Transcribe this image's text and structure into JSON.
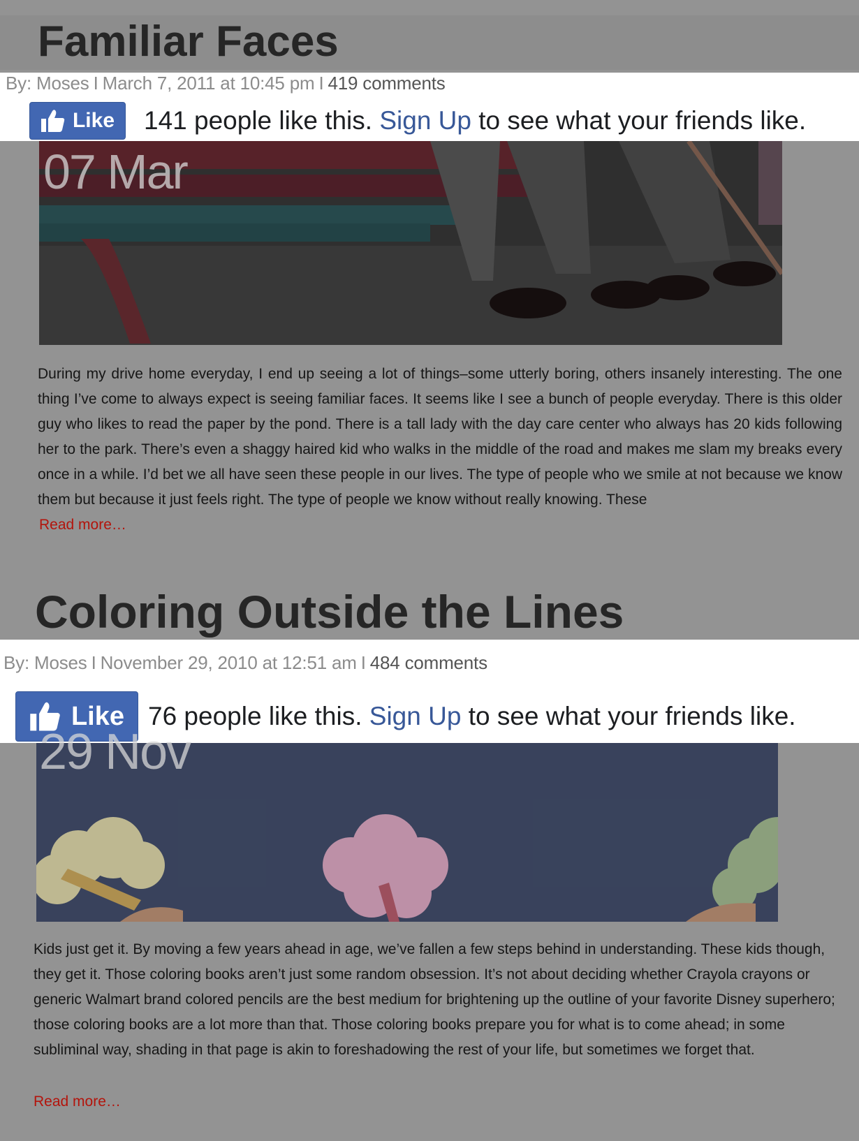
{
  "posts": [
    {
      "title": "Familiar Faces",
      "meta": {
        "by": "By: Moses",
        "sep1": "I",
        "date": "March 7, 2011 at 10:45 pm",
        "sep2": "I",
        "comment_count": "419",
        "comments_label": "comments"
      },
      "like": {
        "button_label": "Like",
        "count_text": "141 people like this.",
        "signup_link": "Sign Up",
        "suffix": "to see what your friends like."
      },
      "date_overlay": "07 Mar",
      "excerpt": "During my drive home everyday, I end up seeing a lot of things–some utterly boring, others insanely interesting.  The one thing I’ve come to always expect is seeing familiar faces.  It seems like I see a bunch of people everyday.  There is this older guy who likes to read the paper by the pond.  There is a tall lady with the day care center who always has 20 kids following her to the park.  There’s even a shaggy haired kid who walks in the middle of the road and makes me slam my breaks every once in a while.  I’d bet we all have seen these people in our lives.  The type of people who we smile at not because we know them but because it just feels right.  The type of people we know without really knowing.  These",
      "read_more": "Read more…"
    },
    {
      "title": "Coloring Outside the Lines",
      "meta": {
        "by": "By: Moses",
        "sep1": "I",
        "date": "November 29, 2010 at 12:51 am",
        "sep2": "I",
        "comment_count": "484",
        "comments_label": "comments"
      },
      "like": {
        "button_label": "Like",
        "count_text": "76 people like this.",
        "signup_link": "Sign Up",
        "suffix": "to see what your friends like."
      },
      "date_overlay": "29 Nov",
      "excerpt": "Kids just get it. By moving a few years ahead in age, we’ve fallen a few steps behind in understanding. These kids though, they get it. Those coloring books aren’t just some random obsession. It’s not about deciding whether Crayola crayons or generic Walmart brand colored pencils are the best medium for brightening up the outline of your favorite Disney superhero; those coloring books are a lot more than that.  Those coloring books prepare you for what is to come ahead; in some subliminal way, shading in that page is akin to foreshadowing the rest of your life, but sometimes we forget that.",
      "read_more": "Read more…"
    }
  ],
  "colors": {
    "dim_overlay": "#939393",
    "like_button": "#4267b2",
    "signup_link": "#385898",
    "read_more": "#b3140c",
    "title_text": "#262626"
  },
  "icons": {
    "like_icon": "thumbs-up-icon"
  }
}
